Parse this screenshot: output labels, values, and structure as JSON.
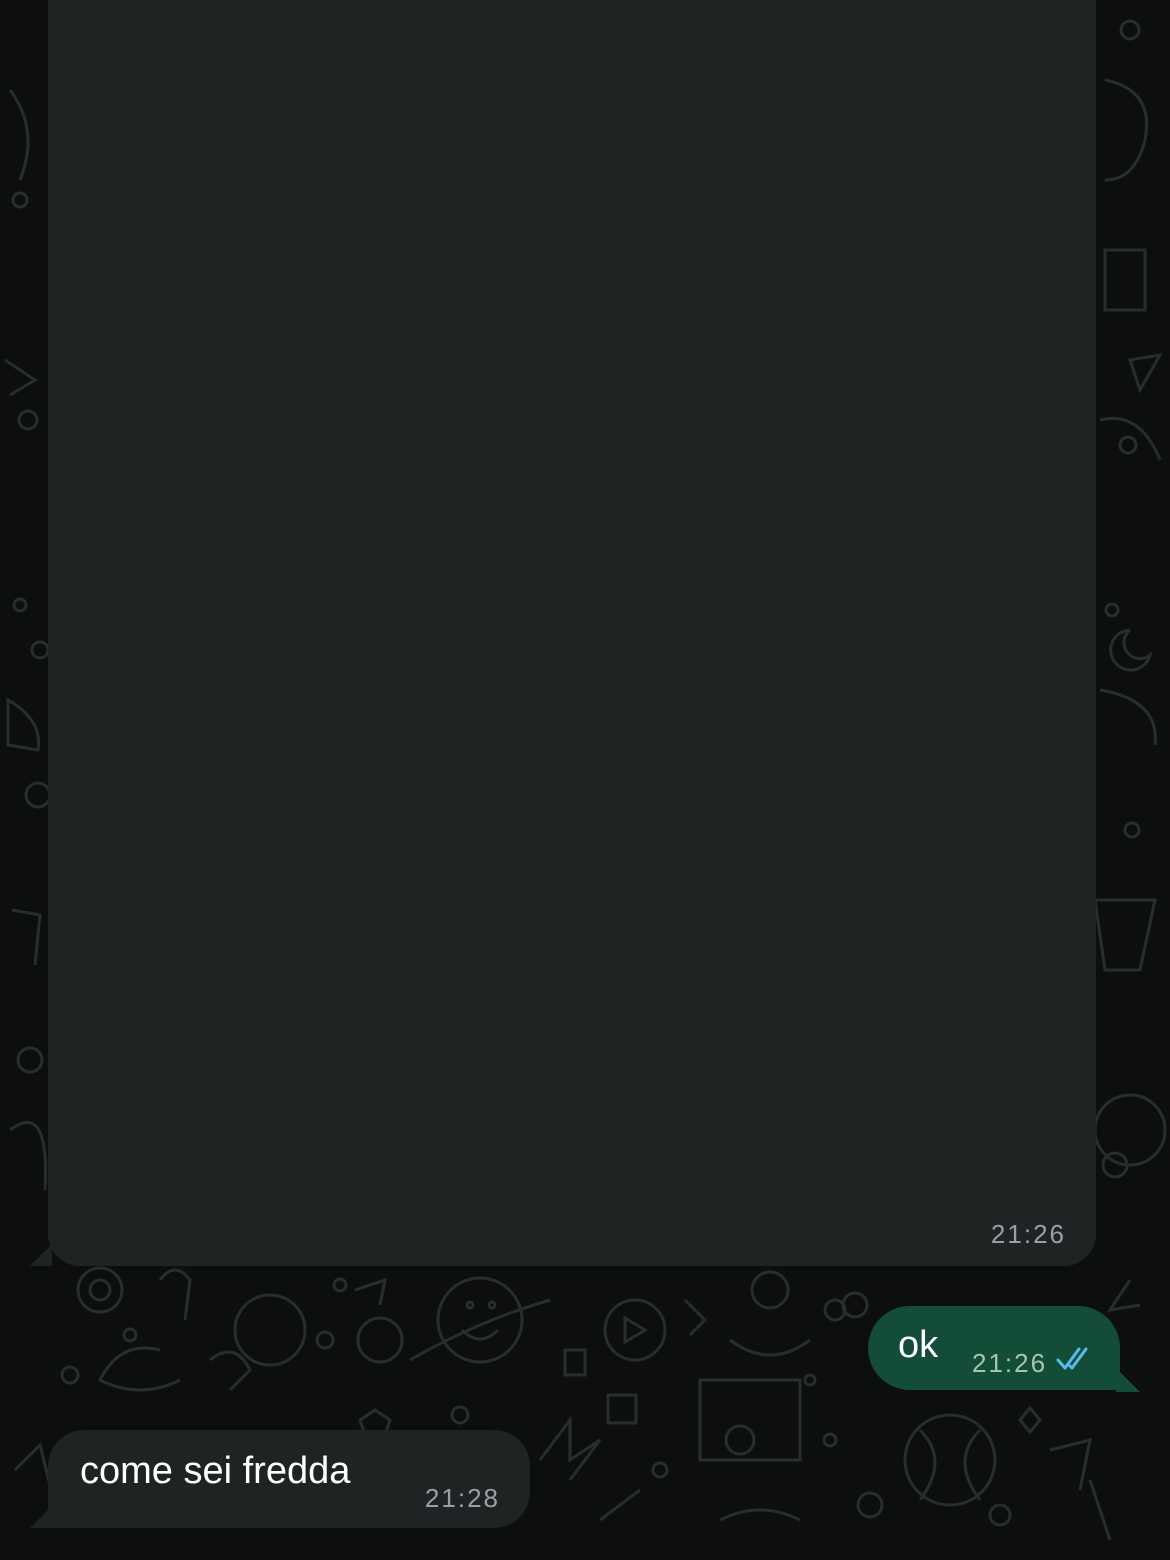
{
  "chat": {
    "messages": [
      {
        "direction": "incoming",
        "kind": "media",
        "text": "",
        "time": "21:26"
      },
      {
        "direction": "outgoing",
        "kind": "text",
        "text": "ok",
        "time": "21:26",
        "status": "read",
        "status_icon": "double-check-icon"
      },
      {
        "direction": "incoming",
        "kind": "text",
        "text": "come sei fredda",
        "time": "21:28"
      }
    ]
  },
  "colors": {
    "background": "#0d0e0e",
    "incoming_bubble": "#202324",
    "outgoing_bubble": "#144d37",
    "read_ticks": "#53bdeb",
    "timestamp": "#9aa0a2"
  }
}
